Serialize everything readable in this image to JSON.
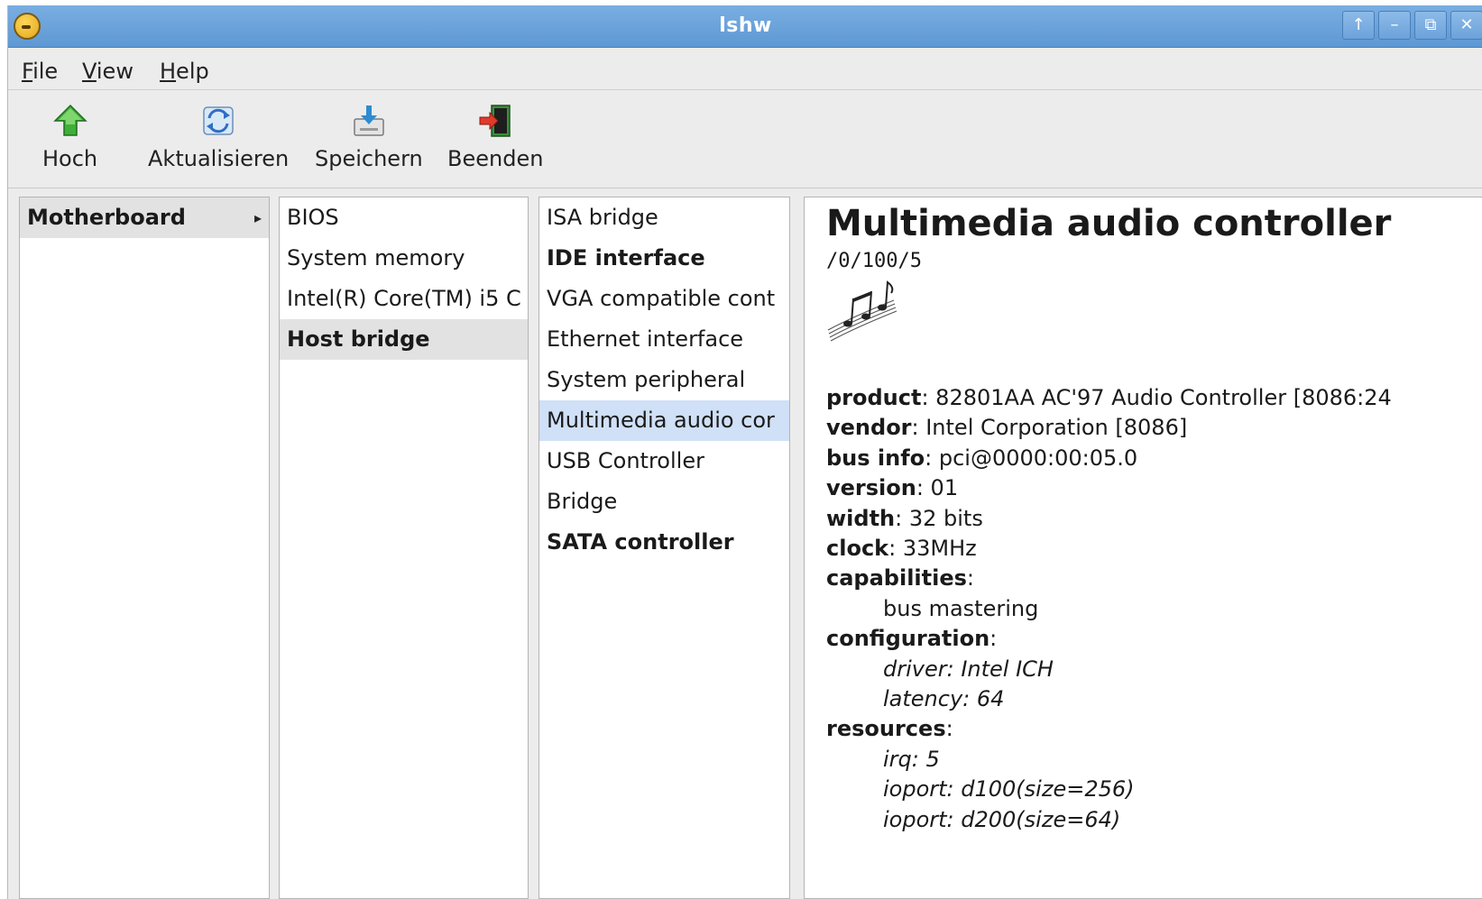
{
  "window": {
    "title": "lshw",
    "buttons": [
      "↑",
      "–",
      "⧉",
      "✕"
    ]
  },
  "menubar": [
    {
      "accel": "F",
      "rest": "ile"
    },
    {
      "accel": "V",
      "rest": "iew"
    },
    {
      "accel": "H",
      "rest": "elp"
    }
  ],
  "toolbar": {
    "up": {
      "label": "Hoch",
      "icon": "up-arrow-icon"
    },
    "refresh": {
      "label": "Aktualisieren",
      "icon": "refresh-icon"
    },
    "save": {
      "label": "Speichern",
      "icon": "save-icon"
    },
    "quit": {
      "label": "Beenden",
      "icon": "exit-icon"
    }
  },
  "columns": {
    "col1": [
      {
        "label": "Motherboard",
        "bold": true,
        "selected": "gray",
        "arrow": "▸"
      }
    ],
    "col2": [
      {
        "label": "BIOS"
      },
      {
        "label": "System memory"
      },
      {
        "label": "Intel(R) Core(TM) i5 C"
      },
      {
        "label": "Host bridge",
        "bold": true,
        "selected": "gray"
      }
    ],
    "col3": [
      {
        "label": "ISA bridge"
      },
      {
        "label": "IDE interface",
        "bold": true
      },
      {
        "label": "VGA compatible cont"
      },
      {
        "label": "Ethernet interface"
      },
      {
        "label": "System peripheral"
      },
      {
        "label": "Multimedia audio cor",
        "selected": "blue"
      },
      {
        "label": "USB Controller"
      },
      {
        "label": "Bridge"
      },
      {
        "label": "SATA controller",
        "bold": true
      }
    ]
  },
  "detail": {
    "title": "Multimedia audio controller",
    "path": "/0/100/5",
    "icon": "music-notes-icon",
    "props": {
      "product_key": "product",
      "product_val": ": 82801AA AC'97 Audio Controller [8086:24",
      "vendor_key": "vendor",
      "vendor_val": ": Intel Corporation [8086]",
      "businfo_key": "bus info",
      "businfo_val": ": pci@0000:00:05.0",
      "version_key": "version",
      "version_val": ": 01",
      "width_key": "width",
      "width_val": ": 32 bits",
      "clock_key": "clock",
      "clock_val": ": 33MHz",
      "cap_key": "capabilities",
      "cap_colon": ":",
      "cap_1": "bus mastering",
      "conf_key": "configuration",
      "conf_colon": ":",
      "conf_1": "driver: Intel ICH",
      "conf_2": "latency: 64",
      "res_key": "resources",
      "res_colon": ":",
      "res_1": "irq: 5",
      "res_2": "ioport: d100(size=256)",
      "res_3": "ioport: d200(size=64)"
    }
  }
}
